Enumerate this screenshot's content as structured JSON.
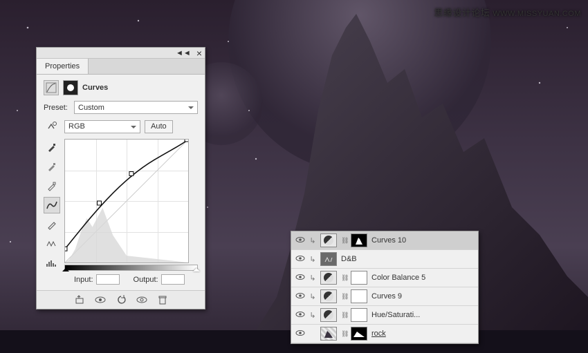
{
  "watermark": {
    "cn": "思缘设计论坛",
    "url": "WWW.MISSYUAN.COM"
  },
  "properties": {
    "collapse_glyph": "◄◄",
    "close_glyph": "×",
    "tab_label": "Properties",
    "adj_label": "Curves",
    "preset_label": "Preset:",
    "preset_value": "Custom",
    "channel_value": "RGB",
    "auto_label": "Auto",
    "input_label": "Input:",
    "output_label": "Output:",
    "tools": {
      "eyedrop": "eyedropper",
      "eyedrop_plus": "eyedropper-plus",
      "eyedrop_minus": "eyedropper-minus",
      "curve": "direct-curve",
      "pencil": "pencil",
      "smooth": "smooth"
    },
    "bottom_icons": [
      "clip-to-layer",
      "view-previous",
      "reset",
      "toggle-visibility",
      "delete"
    ]
  },
  "layers": [
    {
      "vis": "👁",
      "clip": "↳",
      "type": "adj-circle",
      "link": "⛓",
      "mask": "shape",
      "name": "Curves 10",
      "selected": true
    },
    {
      "vis": "👁",
      "clip": "↳",
      "type": "solid-grey",
      "link": "",
      "mask": "none",
      "name": "D&B",
      "selected": false
    },
    {
      "vis": "👁",
      "clip": "↳",
      "type": "adj-circle",
      "link": "⛓",
      "mask": "white",
      "name": "Color Balance 5",
      "selected": false
    },
    {
      "vis": "👁",
      "clip": "↳",
      "type": "adj-circle",
      "link": "⛓",
      "mask": "white",
      "name": "Curves 9",
      "selected": false
    },
    {
      "vis": "👁",
      "clip": "↳",
      "type": "adj-circle",
      "link": "⛓",
      "mask": "white",
      "name": "Hue/Saturati...",
      "selected": false
    },
    {
      "vis": "👁",
      "clip": "",
      "type": "rock-thumb",
      "link": "⛓",
      "mask": "rock",
      "name": "rock",
      "selected": false
    }
  ],
  "chart_data": {
    "type": "line",
    "title": "Curves",
    "xlabel": "Input",
    "ylabel": "Output",
    "x": [
      0,
      71,
      137,
      255
    ],
    "y": [
      28,
      124,
      185,
      255
    ],
    "xlim": [
      0,
      255
    ],
    "ylim": [
      0,
      255
    ],
    "series": [
      {
        "name": "RGB",
        "values": [
          [
            0,
            28
          ],
          [
            71,
            124
          ],
          [
            137,
            185
          ],
          [
            255,
            255
          ]
        ]
      }
    ]
  }
}
